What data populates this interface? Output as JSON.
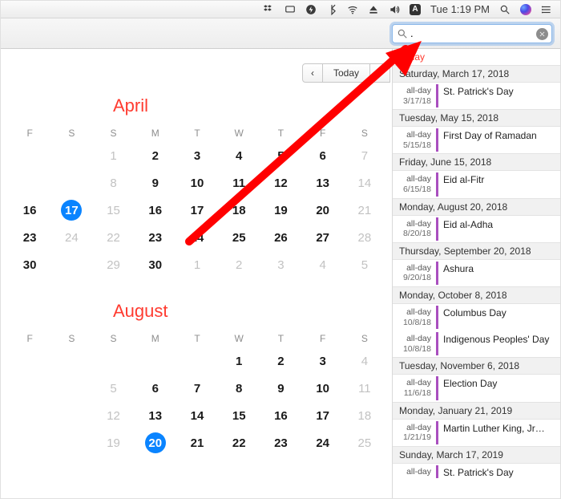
{
  "menubar": {
    "clock": "Tue 1:19 PM",
    "badge_letter": "A"
  },
  "toolbar": {
    "search_value": ".",
    "nav_prev": "‹",
    "nav_today": "Today",
    "nav_next": "›"
  },
  "months": [
    {
      "name": "April",
      "dow": [
        "F",
        "S",
        "S",
        "M",
        "T",
        "W",
        "T",
        "F",
        "S"
      ],
      "weeks": [
        [
          {
            "n": ""
          },
          {
            "n": ""
          },
          {
            "n": "1",
            "dim": true
          },
          {
            "n": "2"
          },
          {
            "n": "3"
          },
          {
            "n": "4"
          },
          {
            "n": "5"
          },
          {
            "n": "6"
          },
          {
            "n": "7",
            "dim": true
          }
        ],
        [
          {
            "n": ""
          },
          {
            "n": ""
          },
          {
            "n": "8",
            "dim": true
          },
          {
            "n": "9"
          },
          {
            "n": "10"
          },
          {
            "n": "11"
          },
          {
            "n": "12"
          },
          {
            "n": "13"
          },
          {
            "n": "14",
            "dim": true
          }
        ],
        [
          {
            "n": "16"
          },
          {
            "n": "17",
            "today": true
          },
          {
            "n": "15",
            "dim": true
          },
          {
            "n": "16"
          },
          {
            "n": "17"
          },
          {
            "n": "18"
          },
          {
            "n": "19"
          },
          {
            "n": "20"
          },
          {
            "n": "21",
            "dim": true
          }
        ],
        [
          {
            "n": "23"
          },
          {
            "n": "24",
            "dim": true
          },
          {
            "n": "22",
            "dim": true
          },
          {
            "n": "23"
          },
          {
            "n": "24"
          },
          {
            "n": "25"
          },
          {
            "n": "26"
          },
          {
            "n": "27"
          },
          {
            "n": "28",
            "dim": true
          }
        ],
        [
          {
            "n": "30"
          },
          {
            "n": ""
          },
          {
            "n": "29",
            "dim": true
          },
          {
            "n": "30"
          },
          {
            "n": "1",
            "dim": true
          },
          {
            "n": "2",
            "dim": true
          },
          {
            "n": "3",
            "dim": true
          },
          {
            "n": "4",
            "dim": true
          },
          {
            "n": "5",
            "dim": true
          }
        ]
      ]
    },
    {
      "name": "August",
      "dow": [
        "F",
        "S",
        "S",
        "M",
        "T",
        "W",
        "T",
        "F",
        "S"
      ],
      "weeks": [
        [
          {
            "n": ""
          },
          {
            "n": ""
          },
          {
            "n": ""
          },
          {
            "n": ""
          },
          {
            "n": ""
          },
          {
            "n": "1"
          },
          {
            "n": "2"
          },
          {
            "n": "3"
          },
          {
            "n": "4",
            "dim": true
          }
        ],
        [
          {
            "n": ""
          },
          {
            "n": ""
          },
          {
            "n": "5",
            "dim": true
          },
          {
            "n": "6"
          },
          {
            "n": "7"
          },
          {
            "n": "8"
          },
          {
            "n": "9"
          },
          {
            "n": "10"
          },
          {
            "n": "11",
            "dim": true
          }
        ],
        [
          {
            "n": ""
          },
          {
            "n": ""
          },
          {
            "n": "12",
            "dim": true
          },
          {
            "n": "13"
          },
          {
            "n": "14"
          },
          {
            "n": "15"
          },
          {
            "n": "16"
          },
          {
            "n": "17"
          },
          {
            "n": "18",
            "dim": true
          }
        ],
        [
          {
            "n": ""
          },
          {
            "n": ""
          },
          {
            "n": "19",
            "dim": true
          },
          {
            "n": "20",
            "today": true
          },
          {
            "n": "21"
          },
          {
            "n": "22"
          },
          {
            "n": "23"
          },
          {
            "n": "24"
          },
          {
            "n": "25",
            "dim": true
          }
        ]
      ]
    }
  ],
  "results": {
    "heading": "Today",
    "groups": [
      {
        "date": "Saturday, March 17, 2018",
        "events": [
          {
            "allday": "all-day",
            "short": "3/17/18",
            "title": "St. Patrick's Day"
          }
        ]
      },
      {
        "date": "Tuesday, May 15, 2018",
        "events": [
          {
            "allday": "all-day",
            "short": "5/15/18",
            "title": "First Day of Ramadan"
          }
        ]
      },
      {
        "date": "Friday, June 15, 2018",
        "events": [
          {
            "allday": "all-day",
            "short": "6/15/18",
            "title": "Eid al-Fitr"
          }
        ]
      },
      {
        "date": "Monday, August 20, 2018",
        "events": [
          {
            "allday": "all-day",
            "short": "8/20/18",
            "title": "Eid al-Adha"
          }
        ]
      },
      {
        "date": "Thursday, September 20, 2018",
        "events": [
          {
            "allday": "all-day",
            "short": "9/20/18",
            "title": "Ashura"
          }
        ]
      },
      {
        "date": "Monday, October 8, 2018",
        "events": [
          {
            "allday": "all-day",
            "short": "10/8/18",
            "title": "Columbus Day"
          },
          {
            "allday": "all-day",
            "short": "10/8/18",
            "title": "Indigenous Peoples' Day"
          }
        ]
      },
      {
        "date": "Tuesday, November 6, 2018",
        "events": [
          {
            "allday": "all-day",
            "short": "11/6/18",
            "title": "Election Day"
          }
        ]
      },
      {
        "date": "Monday, January 21, 2019",
        "events": [
          {
            "allday": "all-day",
            "short": "1/21/19",
            "title": "Martin Luther King, Jr…"
          }
        ]
      },
      {
        "date": "Sunday, March 17, 2019",
        "events": [
          {
            "allday": "all-day",
            "short": "",
            "title": "St. Patrick's Day"
          }
        ]
      }
    ]
  }
}
